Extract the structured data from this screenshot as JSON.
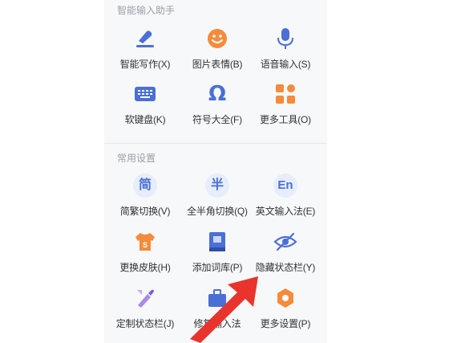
{
  "sections": {
    "assistant": {
      "title": "智能输入助手"
    },
    "settings": {
      "title": "常用设置"
    }
  },
  "items": {
    "smart_write": {
      "label": "智能写作(X)",
      "icon": "pen-icon"
    },
    "emoji": {
      "label": "图片表情(B)",
      "icon": "smiley-icon"
    },
    "voice": {
      "label": "语音输入(S)",
      "icon": "microphone-icon"
    },
    "soft_keyboard": {
      "label": "软键盘(K)",
      "icon": "keyboard-icon"
    },
    "symbols": {
      "label": "符号大全(F)",
      "icon": "omega-icon"
    },
    "more_tools": {
      "label": "更多工具(O)",
      "icon": "grid-icon"
    },
    "trad_simp": {
      "label": "简繁切换(V)",
      "icon_text": "简"
    },
    "full_half": {
      "label": "全半角切换(Q)",
      "icon_text": "半"
    },
    "english": {
      "label": "英文输入法(E)",
      "icon_text": "En"
    },
    "skin": {
      "label": "更换皮肤(H)",
      "icon": "shirt-icon"
    },
    "add_dict": {
      "label": "添加词库(P)",
      "icon": "book-icon"
    },
    "hide_status": {
      "label": "隐藏状态栏(Y)",
      "icon": "eye-hidden-icon"
    },
    "custom_status": {
      "label": "定制状态栏(J)",
      "icon": "brush-icon"
    },
    "repair": {
      "label": "修复输入法",
      "icon": "toolbox-icon"
    },
    "more_settings": {
      "label": "更多设置(P)",
      "icon": "gear-icon"
    }
  },
  "colors": {
    "accent_blue": "#4a6fd6",
    "orange": "#f58b3b",
    "arrow_red": "#e8342c"
  }
}
